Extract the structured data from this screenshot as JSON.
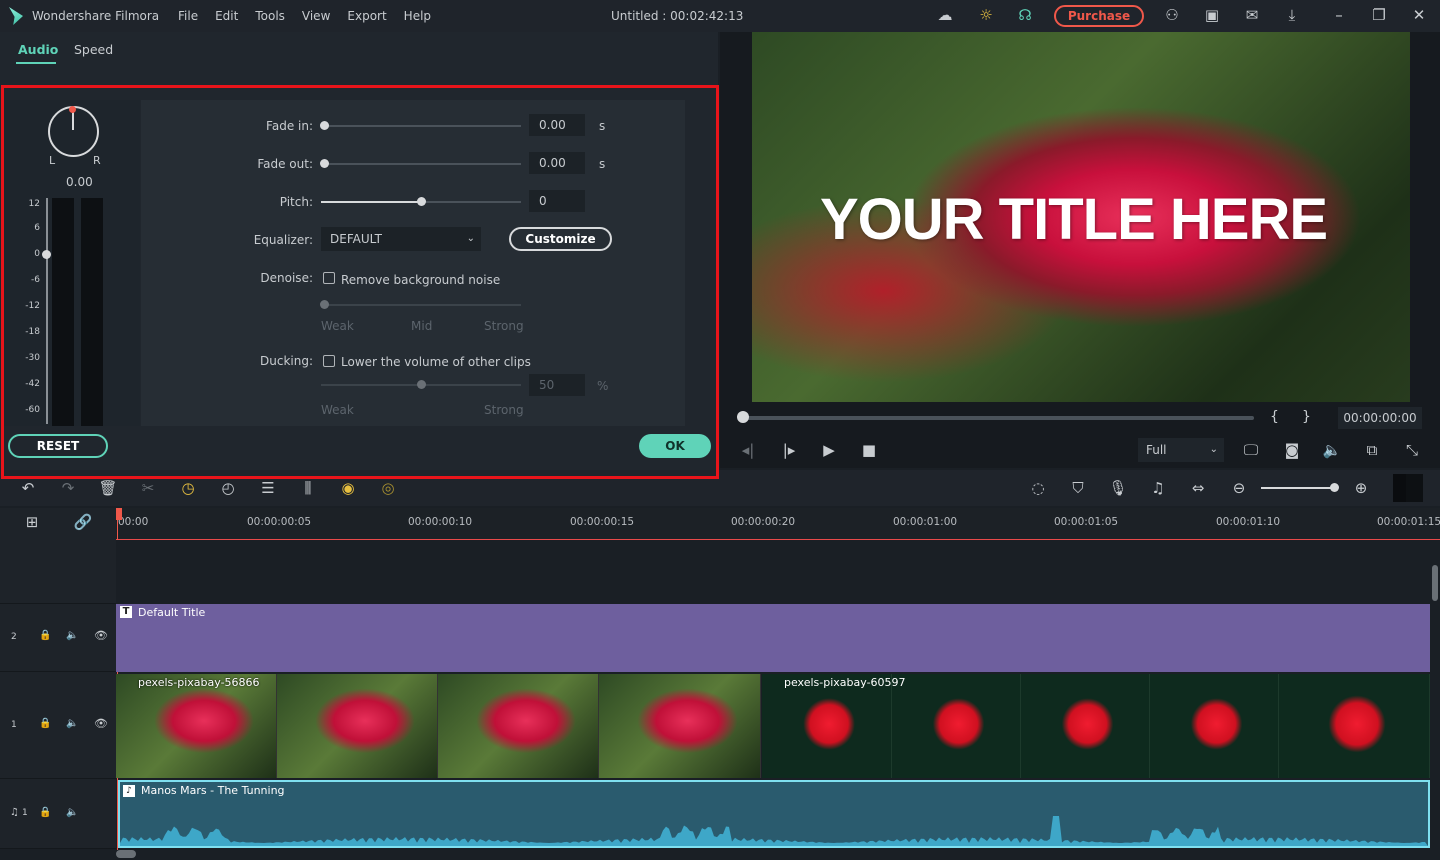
{
  "app": {
    "name": "Wondershare Filmora",
    "title": "Untitled : 00:02:42:13",
    "menu": [
      "File",
      "Edit",
      "Tools",
      "View",
      "Export",
      "Help"
    ],
    "purchase": "Purchase",
    "accent": "#5fd3b8",
    "highlight": "#e8141a"
  },
  "tabs": [
    {
      "label": "Audio",
      "active": true
    },
    {
      "label": "Speed",
      "active": false
    }
  ],
  "meter": {
    "pan_left": "L",
    "pan_right": "R",
    "pan_value": "0.00",
    "scale": [
      "12",
      "6",
      "0",
      "-6",
      "-12",
      "-18",
      "-30",
      "-42",
      "-60"
    ],
    "volume_db": 0
  },
  "audio": {
    "fade_in": {
      "label": "Fade in:",
      "value": "0.00",
      "unit": "s"
    },
    "fade_out": {
      "label": "Fade out:",
      "value": "0.00",
      "unit": "s"
    },
    "pitch": {
      "label": "Pitch:",
      "value": "0"
    },
    "equalizer": {
      "label": "Equalizer:",
      "value": "DEFAULT",
      "customize": "Customize"
    },
    "denoise": {
      "label": "Denoise:",
      "checkbox": "Remove background noise",
      "checked": false,
      "levels": [
        "Weak",
        "Mid",
        "Strong"
      ]
    },
    "ducking": {
      "label": "Ducking:",
      "checkbox": "Lower the volume of other clips",
      "checked": false,
      "value": "50",
      "unit": "%",
      "levels": [
        "Weak",
        "Strong"
      ]
    },
    "reset": "RESET",
    "ok": "OK"
  },
  "preview": {
    "title_text": "YOUR TITLE HERE",
    "timecode": "00:00:00:00",
    "mark_in": "{",
    "mark_out": "}",
    "quality": "Full",
    "progress": 0
  },
  "ruler": [
    "00:00",
    "00:00:00:05",
    "00:00:00:10",
    "00:00:00:15",
    "00:00:00:20",
    "00:00:01:00",
    "00:00:01:05",
    "00:00:01:10",
    "00:00:01:15"
  ],
  "tracks": {
    "title_track": {
      "num": "2",
      "clip": "Default Title",
      "color": "#6e5f9e"
    },
    "video_track": {
      "num": "1",
      "clips": [
        "pexels-pixabay-56866",
        "pexels-pixabay-60597"
      ]
    },
    "audio_track": {
      "num": "1",
      "clip": "Manos Mars - The Tunning",
      "color": "#2a5b6e"
    }
  }
}
